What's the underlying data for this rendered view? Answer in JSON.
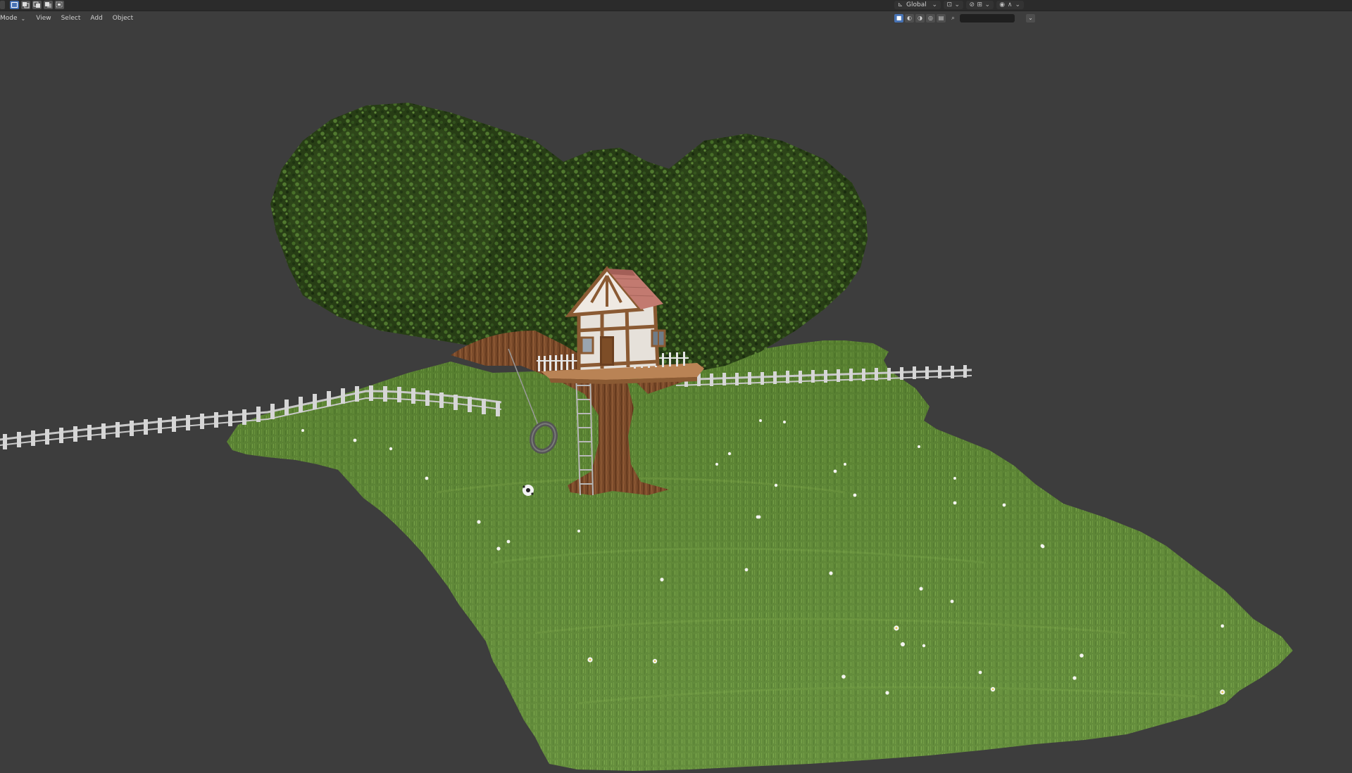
{
  "toolbar": {
    "select_modes": [
      "select-box",
      "select-extend",
      "select-subtract",
      "select-difference",
      "select-intersect"
    ]
  },
  "header": {
    "mode_label": "Mode",
    "menus": [
      "View",
      "Select",
      "Add",
      "Object"
    ]
  },
  "transform": {
    "orientation": "Global"
  },
  "shading": {
    "modes": [
      "solid",
      "material-preview",
      "rendered",
      "wireframe"
    ]
  },
  "colors": {
    "viewport_bg": "#3d3d3d",
    "header_bg": "#2b2b2b",
    "accent_active": "#4772b3",
    "grass": "#5e8a32",
    "foliage": "#2f4b1b",
    "bark": "#7a4a2a",
    "roof": "#b86e66",
    "fence": "#c8c8c8"
  }
}
